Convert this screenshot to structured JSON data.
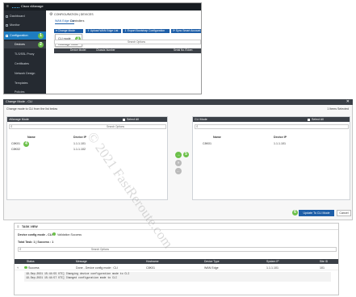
{
  "vmanage": {
    "brand": "Cisco vManage",
    "nav": {
      "dashboard": "Dashboard",
      "monitor": "Monitor",
      "configuration": "Configuration",
      "devices": "Devices",
      "tls_proxy": "TLS/SSL Proxy",
      "certificates": "Certificates",
      "network_design": "Network Design",
      "templates": "Templates",
      "policies": "Policies"
    },
    "breadcrumb": "CONFIGURATION | DEVICES",
    "tabs": [
      "WAN Edge List",
      "Controllers"
    ],
    "toolbar": {
      "change_mode": "Change Mode",
      "upload_wan_edge": "Upload WAN Edge List",
      "export_bootstrap": "Export Bootstrap Configuration",
      "sync_smart": "Sync Smart Account"
    },
    "menu": [
      "CLI mode",
      "vManage mode"
    ],
    "search_options": "Search Options",
    "table_headers": [
      "Device Model",
      "Chassis Number",
      "Serial No./Token"
    ]
  },
  "change_mode": {
    "title": "Change Mode - CLI",
    "subtitle": "Change mode to CLI from the list below",
    "selected_count": "1 Items Selected",
    "left_header": "vManage Mode",
    "right_header": "CLI Mode",
    "select_all": "Select All",
    "search_options": "Search Options",
    "columns": [
      "Name",
      "Device IP"
    ],
    "left_rows": [
      {
        "name": "C8K01",
        "ip": "1.1.1.101"
      },
      {
        "name": "C8K02",
        "ip": "1.1.1.102"
      }
    ],
    "right_rows": [
      {
        "name": "C8K01",
        "ip": "1.1.1.101"
      }
    ],
    "update_button": "Update To CLI Mode",
    "cancel_button": "Cancel"
  },
  "task_view": {
    "title": "TASK VIEW",
    "status_line": "Device config mode - CLI",
    "validation": "Validation Success",
    "total_task": "Total Task: 1 | Success : 1",
    "search_options": "Search Options",
    "columns": [
      "Status",
      "Message",
      "Hostname",
      "Device Type",
      "System IP",
      "Site ID"
    ],
    "row": {
      "status": "Success",
      "message": "Done - Device config mode : CLI",
      "hostname": "C8K01",
      "device_type": "WAN Edge",
      "system_ip": "1.1.1.101",
      "site_id": "101"
    },
    "log": [
      "19-Sep-2021 15:44:55 UTC] Changing device configuration mode to CLI",
      "19-Sep-2021 15:44:57 UTC] Changed configuration mode to CLI"
    ]
  },
  "badges": [
    "1",
    "2",
    "3",
    "4",
    "5",
    "6"
  ],
  "watermark": "© 2021 FastReroute.com",
  "colors": {
    "sidebar": "#252a31",
    "accent_green": "#6cc04a",
    "button_blue": "#1f5fa8",
    "header_dark": "#3b4047"
  }
}
